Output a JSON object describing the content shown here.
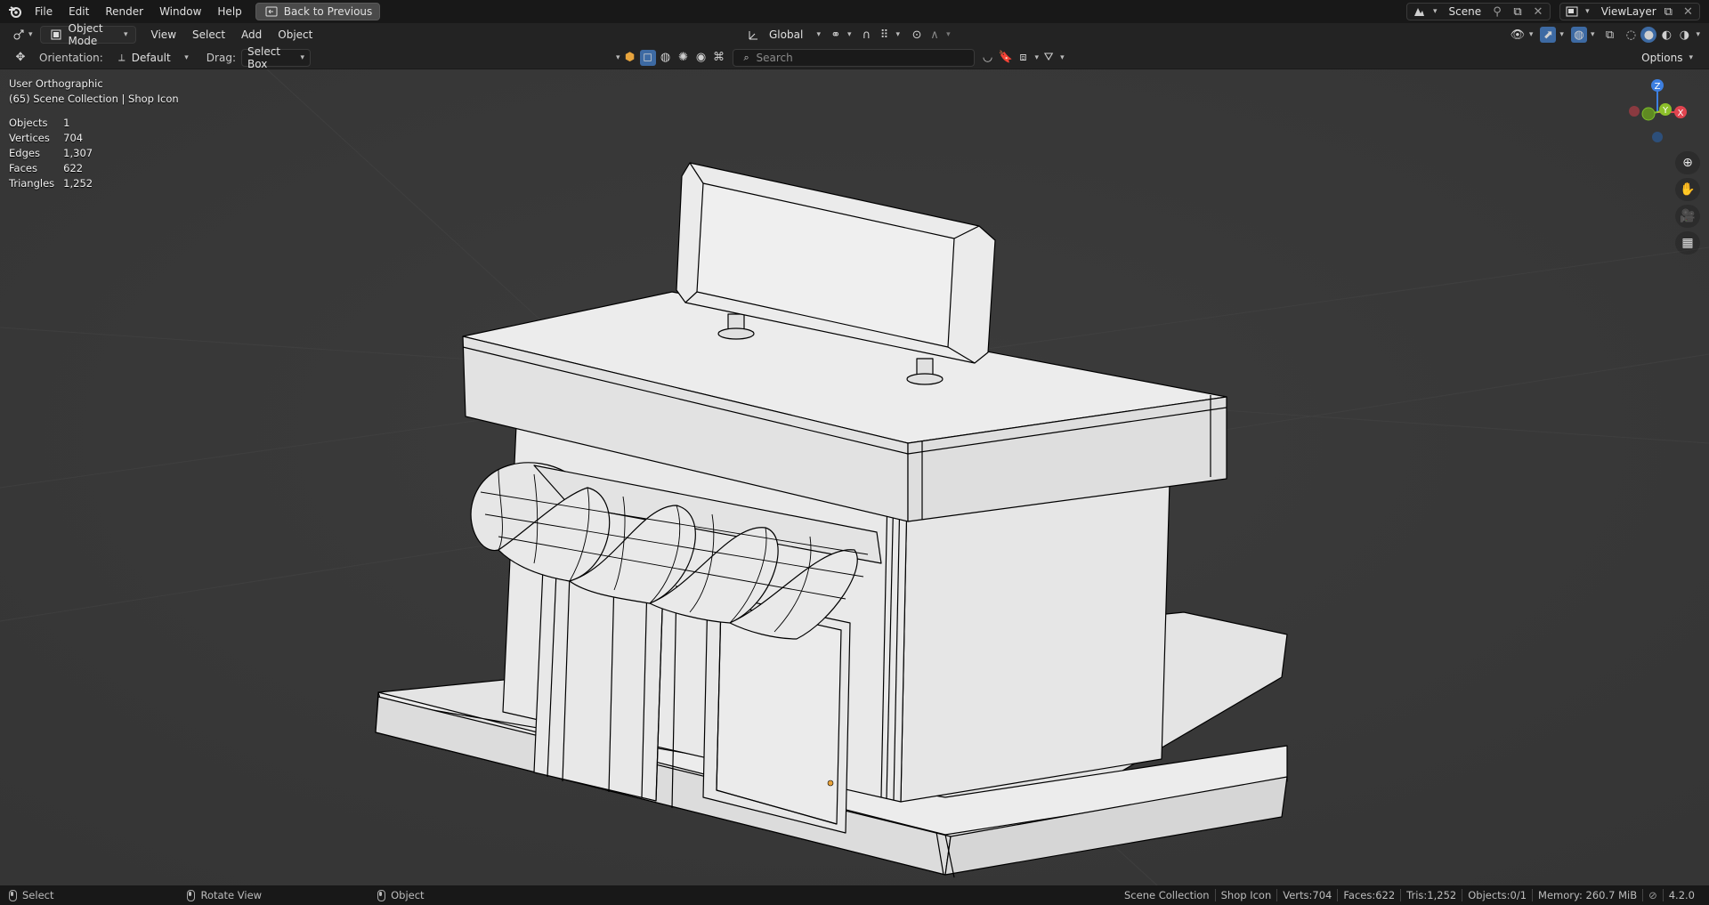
{
  "topbar": {
    "menus": [
      "File",
      "Edit",
      "Render",
      "Window",
      "Help"
    ],
    "back_button": "Back to Previous",
    "scene_name": "Scene",
    "view_layer_name": "ViewLayer"
  },
  "header": {
    "mode": "Object Mode",
    "menus": [
      "View",
      "Select",
      "Add",
      "Object"
    ],
    "transform_orientation": "Global"
  },
  "tool_settings": {
    "orientation_label": "Orientation:",
    "orientation_value": "Default",
    "drag_label": "Drag:",
    "drag_value": "Select Box",
    "search_placeholder": "Search",
    "options_label": "Options"
  },
  "viewport": {
    "view_name": "User Orthographic",
    "collection_line": "(65) Scene Collection | Shop Icon",
    "stats": [
      {
        "label": "Objects",
        "value": "1"
      },
      {
        "label": "Vertices",
        "value": "704"
      },
      {
        "label": "Edges",
        "value": "1,307"
      },
      {
        "label": "Faces",
        "value": "622"
      },
      {
        "label": "Triangles",
        "value": "1,252"
      }
    ],
    "gizmo_axes": {
      "z": "Z",
      "y": "Y",
      "x": "X"
    }
  },
  "statusbar": {
    "left": [
      {
        "label": "Select"
      },
      {
        "label": "Rotate View"
      },
      {
        "label": "Object"
      }
    ],
    "collection": "Scene Collection",
    "object": "Shop Icon",
    "verts": "Verts:704",
    "faces": "Faces:622",
    "tris": "Tris:1,252",
    "objects": "Objects:0/1",
    "memory": "Memory: 260.7 MiB",
    "version": "4.2.0"
  },
  "colors": {
    "axis_x": "#e0444f",
    "axis_y": "#7cbf2a",
    "axis_z": "#3d7fe0",
    "accent": "#3d6aa3",
    "mesh_face": "#e9e9e9",
    "wire": "#000000"
  }
}
